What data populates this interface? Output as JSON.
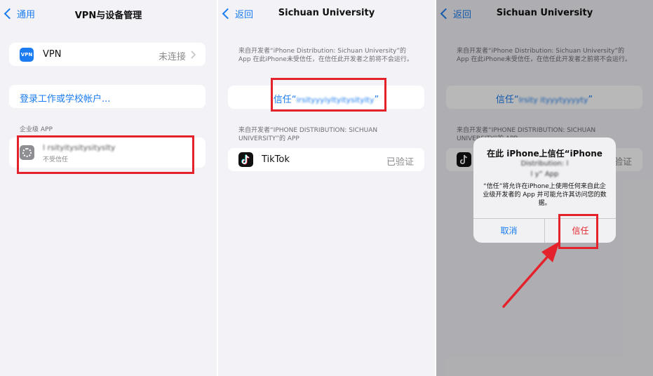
{
  "colors": {
    "accent": "#1a7cf0",
    "highlight": "#e4222b",
    "background": "#f2f2f7"
  },
  "panel1": {
    "back_label": "通用",
    "title": "VPN与设备管理",
    "vpn_icon_text": "VPN",
    "vpn_label": "VPN",
    "vpn_status": "未连接",
    "login_link": "登录工作或学校帐户...",
    "section_header": "企业级 APP",
    "profile_name": "l rsityitysitysityslty",
    "profile_status": "不受信任"
  },
  "panel2": {
    "back_label": "返回",
    "title": "Sichuan University",
    "caption1": "来自开发者“iPhone Distribution: Sichuan University”的 App 在此iPhone未受信任，在信任此开发者之前将不会运行。",
    "trust_prefix": "信任“",
    "trust_name": "irsityyyiyltyitysityity",
    "trust_suffix": "”",
    "caption2": "来自开发者“IPHONE DISTRIBUTION: SICHUAN UNIVERSITY”的 APP",
    "app_name": "TikTok",
    "app_status": "已验证"
  },
  "panel3": {
    "back_label": "返回",
    "title": "Sichuan University",
    "caption1": "来自开发者“iPhone Distribution: Sichuan University”的 App 在此iPhone未受信任，在信任此开发者之前将不会运行。",
    "trust_prefix": "信任“",
    "trust_name": "lrsity ityyytyyyyty",
    "trust_suffix": "”",
    "caption2": "来自开发者“IPHONE DISTRIBUTION: SICHUAN UNIVERSITY”的 APP",
    "app_status_partial": "验证",
    "alert": {
      "title": "在此 iPhone上信任“iPhone",
      "blur_line1": "Distribution: l",
      "blur_line2": "l          y” App",
      "message": "“信任”将允许在iPhone上使用任何来自此企业级开发者的 App 并可能允许其访问您的数据。",
      "cancel_label": "取消",
      "trust_label": "信任"
    }
  }
}
